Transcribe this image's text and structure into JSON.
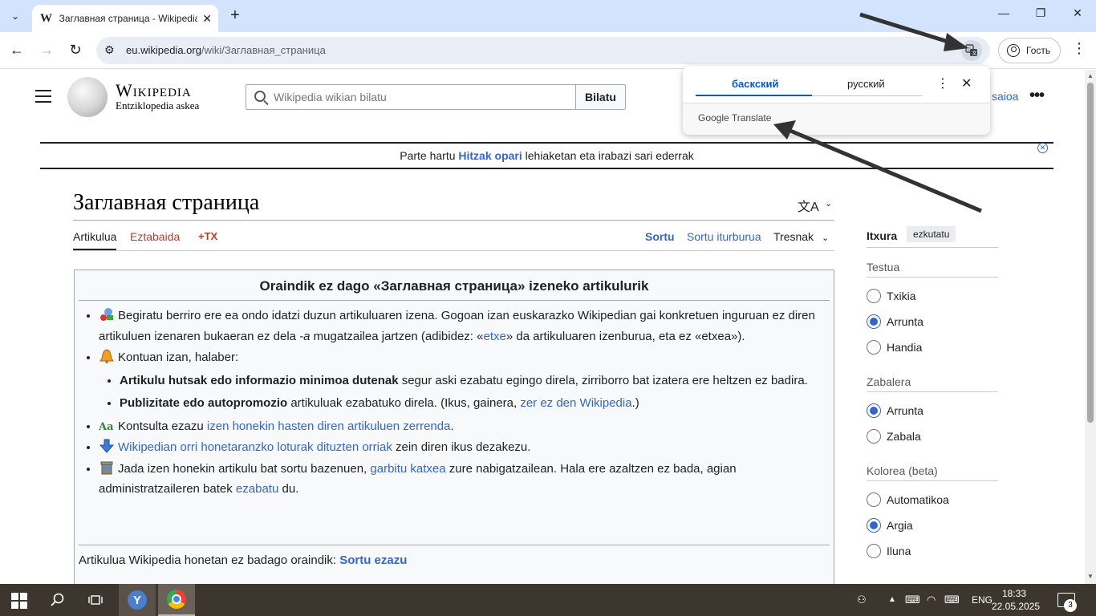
{
  "browser": {
    "tab_title": "Заглавная страница - Wikipedia",
    "tab_favicon": "W",
    "url_host": "eu.wikipedia.org",
    "url_path": "/wiki/Заглавная_страница",
    "guest_label": "Гость",
    "icons": {
      "tab_list": "chevron-down-icon",
      "close_tab": "close-icon",
      "new_tab": "plus-icon",
      "minimize": "minimize-icon",
      "restore": "restore-icon",
      "close_window": "close-icon",
      "back": "arrow-left-icon",
      "forward": "arrow-right-icon",
      "reload": "reload-icon",
      "site_info": "tune-icon",
      "translate": "translate-icon",
      "menu": "kebab-menu-icon"
    }
  },
  "translate_popup": {
    "source_lang": "баскский",
    "target_lang": "русский",
    "footer_brand": "Google",
    "footer_product": "Translate",
    "accent_color": "#0b57d0"
  },
  "wiki": {
    "wordmark": "Wikipedia",
    "tagline": "Entziklopedia askea",
    "search_placeholder": "Wikipedia wikian bilatu",
    "search_button": "Bilatu",
    "login_link": "saioa",
    "banner": {
      "before": "Parte hartu ",
      "link": "Hitzak opari",
      "after": " lehiaketan eta irabazi sari ederrak"
    },
    "page_title": "Заглавная страница",
    "tabs": {
      "article": "Artikulua",
      "talk": "Eztabaida",
      "tx": "+TX",
      "create": "Sortu",
      "create_source": "Sortu iturburua",
      "tools": "Tresnak"
    },
    "notice": {
      "title": "Oraindik ez dago «Заглавная страница» izeneko artikulurik",
      "item1_a": "Begiratu berriro ere ea ondo idatzi duzun artikuluaren izena. Gogoan izan euskarazko Wikipedian gai konkretuen inguruan ez diren artikuluen izenaren bukaeran ez dela ",
      "item1_em": "-a",
      "item1_b": " mugatzailea jartzen (adibidez: «",
      "item1_link": "etxe",
      "item1_c": "» da artikuluaren izenburua, eta ez «etxea»).",
      "item2": "Kontuan izan, halaber:",
      "sub1_bold": "Artikulu hutsak edo informazio minimoa dutenak",
      "sub1_rest": " segur aski ezabatu egingo direla, zirriborro bat izatera ere heltzen ez badira.",
      "sub2_bold": "Publizitate edo autopromozio",
      "sub2_rest": " artikuluak ezabatuko direla. (Ikus, gainera, ",
      "sub2_link": "zer ez den Wikipedia",
      "sub2_end": ".)",
      "item3_a": "Kontsulta ezazu ",
      "item3_link": "izen honekin hasten diren artikuluen zerrenda",
      "item3_b": ".",
      "item4_link": "Wikipedian orri honetaranzko loturak dituzten orriak",
      "item4_b": " zein diren ikus dezakezu.",
      "item5_a": "Jada izen honekin artikulu bat sortu bazenuen, ",
      "item5_link1": "garbitu katxea",
      "item5_b": " zure nabigatzailean. Hala ere azaltzen ez bada, agian administratzaileren batek ",
      "item5_link2": "ezabatu",
      "item5_c": " du.",
      "footer_text": "Artikulua Wikipedia honetan ez badago oraindik: ",
      "footer_link": "Sortu ezazu"
    },
    "appearance": {
      "heading": "Itxura",
      "hide": "ezkutatu",
      "text_label": "Testua",
      "text_options": [
        "Txikia",
        "Arrunta",
        "Handia"
      ],
      "text_selected": 1,
      "width_label": "Zabalera",
      "width_options": [
        "Arrunta",
        "Zabala"
      ],
      "width_selected": 0,
      "color_label": "Kolorea (beta)",
      "color_options": [
        "Automatikoa",
        "Argia",
        "Iluna"
      ],
      "color_selected": 1
    },
    "link_color": "#3366cc"
  },
  "taskbar": {
    "lang": "ENG",
    "time": "18:33",
    "date": "22.05.2025",
    "notification_count": "3",
    "yandex_letter": "Y"
  }
}
